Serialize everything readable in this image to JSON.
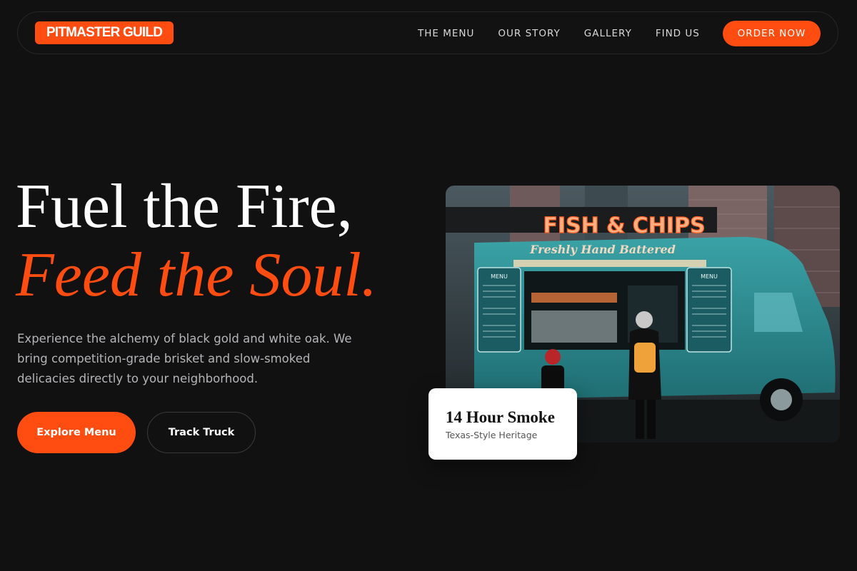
{
  "brand": {
    "logo_text": "PITMASTER GUILD",
    "accent": "#ff4d12",
    "background": "#111112"
  },
  "nav": {
    "links": [
      {
        "label": "THE MENU"
      },
      {
        "label": "OUR STORY"
      },
      {
        "label": "GALLERY"
      },
      {
        "label": "FIND US"
      }
    ],
    "cta_label": "ORDER NOW"
  },
  "hero": {
    "title_line1": "Fuel the Fire,",
    "title_line2": "Feed the Soul.",
    "description": "Experience the alchemy of black gold and white oak. We bring competition-grade brisket and slow-smoked delicacies directly to your neighborhood.",
    "primary_button": "Explore Menu",
    "secondary_button": "Track Truck"
  },
  "image": {
    "sign_text": "FISH & CHIPS",
    "banner_text": "Freshly Hand Battered",
    "menu_board_label": "MENU"
  },
  "stat_card": {
    "title": "14 Hour Smoke",
    "subtitle": "Texas-Style Heritage"
  }
}
